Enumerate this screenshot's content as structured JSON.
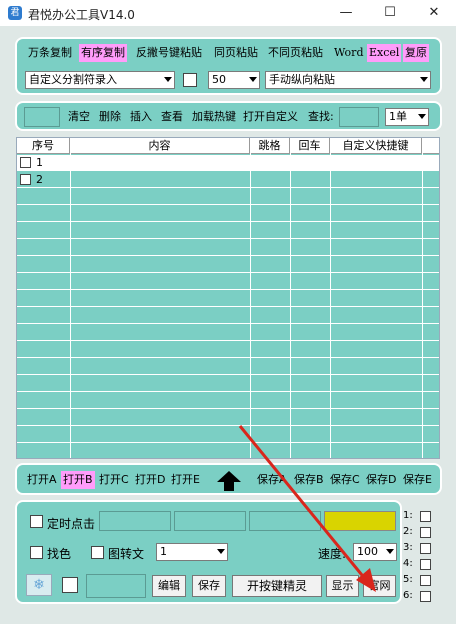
{
  "window": {
    "title": "君悦办公工具V14.0",
    "minimize": "—",
    "maximize": "☐",
    "close": "✕"
  },
  "toolbar1": {
    "buttons": [
      "万条复制",
      "有序复制",
      "反撇号键粘贴",
      "同页粘贴",
      "不同页粘贴",
      "Word",
      "Excel",
      "复原"
    ],
    "separator_select": "自定义分割符录入",
    "count_select": "50",
    "paste_mode_select": "手动纵向粘贴"
  },
  "toolbar2": {
    "buttons": [
      "清空",
      "删除",
      "插入",
      "查看",
      "加载热键",
      "打开自定义"
    ],
    "search_label": "查找:",
    "search_value": "",
    "mode_select": "1单"
  },
  "table": {
    "headers": [
      "序号",
      "内容",
      "跳格",
      "回车",
      "自定义快捷键"
    ],
    "rows": [
      {
        "num": "1"
      },
      {
        "num": "2"
      }
    ]
  },
  "file_bar": {
    "open_buttons": [
      "打开A",
      "打开B",
      "打开C",
      "打开D",
      "打开E"
    ],
    "save_buttons": [
      "保存A",
      "保存B",
      "保存C",
      "保存D",
      "保存E"
    ]
  },
  "bottom": {
    "timer_label": "定时点击",
    "find_color_label": "找色",
    "img_to_text_label": "图转文",
    "mode_select": "1",
    "speed_label": "速度:",
    "speed_select": "100",
    "edit_label": "编辑",
    "save_label": "保存",
    "sprite_label": "开按键精灵",
    "show_label": "显示",
    "website_label": "官网",
    "side_labels": [
      "1:",
      "2:",
      "3:",
      "4:",
      "5:",
      "6:"
    ]
  },
  "colors": {
    "panel": "#7bcfc4",
    "highlight": "#ff9cfa",
    "yellow": "#d9d400"
  }
}
